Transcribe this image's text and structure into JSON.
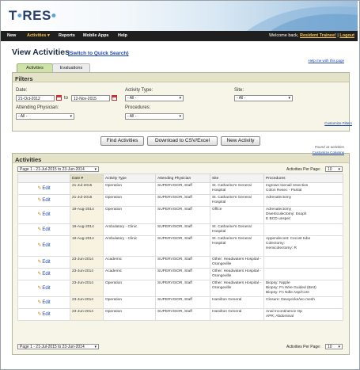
{
  "app": {
    "logo_main": "T",
    "logo_rest": "RES"
  },
  "nav": {
    "items": [
      "New",
      "Activities",
      "Reports",
      "Mobile Apps",
      "Help"
    ],
    "welcome_prefix": "Welcome back,",
    "user": "Resident Trainee!",
    "sep": "|",
    "logout": "Logout"
  },
  "page": {
    "title": "View Activities",
    "quick_search": "(Switch to Quick Search)",
    "help": "Help me with this page",
    "tabs": [
      "Activities",
      "Evaluations"
    ]
  },
  "filters": {
    "title": "Filters",
    "date_label": "Date:",
    "date_from": "21-Oct-2012",
    "date_to_label": "to",
    "date_to": "12-Nov-2015",
    "activity_type_label": "Activity Type:",
    "activity_type_value": "- All -",
    "site_label": "Site:",
    "site_value": "- All -",
    "physician_label": "Attending Physician:",
    "physician_value": "- All -",
    "procedures_label": "Procedures:",
    "procedures_value": "- All -",
    "customize": "Customize Filters"
  },
  "actions": {
    "find": "Find Activities",
    "download": "Download to CSV/Excel",
    "new": "New Activity",
    "found": "Found 11 activities",
    "customize_columns": "Customize Columns"
  },
  "activities": {
    "title": "Activities",
    "pager": "Page 1 - 21-Jul-2015 to 23-Jun-2014",
    "per_page_label": "Activities Per Page:",
    "per_page": "10",
    "columns": [
      "",
      "Date",
      "Activity Type",
      "Attending Physician",
      "Site",
      "Procedures"
    ],
    "edit_label": "Edit",
    "rows": [
      {
        "date": "21-Jul-2015",
        "type": "Operation",
        "physician": "SUPERVISOR, Staff",
        "site": "St. Catharine's General Hospital",
        "procedures": "Ingrown toenail resection\nColon Resec - Partial"
      },
      {
        "date": "21-Jul-2015",
        "type": "Operation",
        "physician": "SUPERVISOR, Staff",
        "site": "St. Catharine's General Hospital",
        "procedures": "Adrenalectomy"
      },
      {
        "date": "19-Aug-2014",
        "type": "Operation",
        "physician": "SUPERVISOR, Staff",
        "site": "Office",
        "procedures": "Adrenalectomy\nDiverticulectomy: Esoph\nE BCD unspec"
      },
      {
        "date": "19-Aug-2014",
        "type": "Ambulatory - Clinic",
        "physician": "SUPERVISOR, Staff",
        "site": "St. Catharine's General Hospital",
        "procedures": ""
      },
      {
        "date": "19-Aug-2014",
        "type": "Ambulatory - Clinic",
        "physician": "SUPERVISOR, Staff",
        "site": "St. Catharine's General Hospital",
        "procedures": "Appendecost: Cecost tube\nColectomy:\nHemicolectomy: R"
      },
      {
        "date": "23-Jun-2014",
        "type": "Academic",
        "physician": "SUPERVISOR, Staff",
        "site": "Other: Headwaters Hospital - Orangeville",
        "procedures": ""
      },
      {
        "date": "23-Jun-2014",
        "type": "Academic",
        "physician": "SUPERVISOR, Staff",
        "site": "Other: Headwaters Hospital - Orangeville",
        "procedures": ""
      },
      {
        "date": "23-Jun-2014",
        "type": "Operation",
        "physician": "SUPERVISOR, Staff",
        "site": "Other: Headwaters Hospital - Orangeville",
        "procedures": "Biopsy: Nipple\nBiopsy: Fn Wire Guided (Brst)\nBiopsy: Fn Ndle Asp/Core"
      },
      {
        "date": "23-Jun-2014",
        "type": "Operation",
        "physician": "SUPERVISOR, Staff",
        "site": "Hamilton General",
        "procedures": "Closure: Dewyecke/wo mesh"
      },
      {
        "date": "23-Jun-2014",
        "type": "Operation",
        "physician": "SUPERVISOR, Staff",
        "site": "Hamilton General",
        "procedures": "Anal Incontinence Op\nAPR; Abdominal"
      }
    ]
  },
  "colors": {
    "nav_bg": "#1f1f1f",
    "accent": "#f2c54a",
    "panel_bg": "#f6f5e8",
    "link": "#1d47b0"
  }
}
